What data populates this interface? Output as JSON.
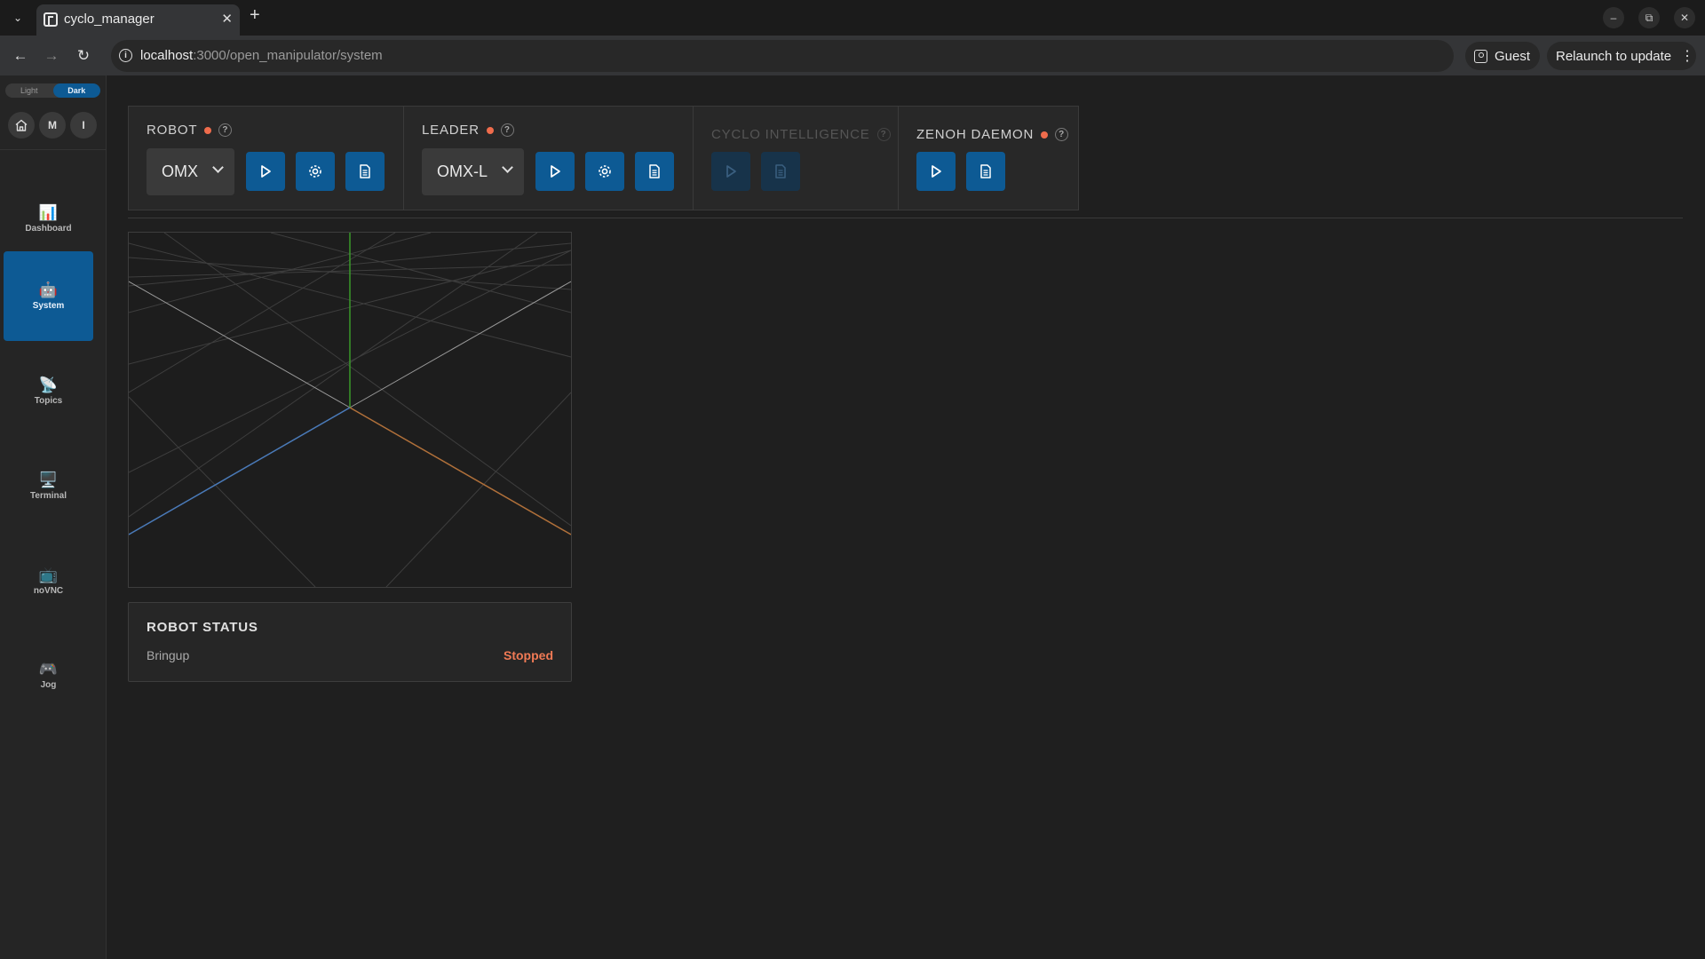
{
  "browser": {
    "tab_title": "cyclo_manager",
    "url_host": "localhost",
    "url_path": ":3000/open_manipulator/system",
    "profile_label": "Guest",
    "relaunch_label": "Relaunch to update"
  },
  "theme_toggle": {
    "light": "Light",
    "dark": "Dark",
    "selected": "Dark"
  },
  "quick_buttons": {
    "m": "M",
    "i": "I"
  },
  "sidebar": {
    "items": [
      {
        "label": "Dashboard",
        "icon": "📊"
      },
      {
        "label": "System",
        "icon": "🤖"
      },
      {
        "label": "Topics",
        "icon": "📡"
      },
      {
        "label": "Terminal",
        "icon": "🖥️"
      },
      {
        "label": "noVNC",
        "icon": "📺"
      },
      {
        "label": "Jog",
        "icon": "🎮"
      }
    ],
    "active": "System"
  },
  "sections": {
    "robot": {
      "title": "ROBOT",
      "help": "?",
      "selected": "OMX"
    },
    "leader": {
      "title": "LEADER",
      "help": "?",
      "selected": "OMX-L"
    },
    "cyclo": {
      "title": "CYCLO INTELLIGENCE",
      "help": "?"
    },
    "zenoh": {
      "title": "ZENOH DAEMON",
      "help": "?"
    }
  },
  "robot_status": {
    "title": "ROBOT STATUS",
    "key": "Bringup",
    "value": "Stopped"
  },
  "colors": {
    "accent": "#0d5a94",
    "status_dot": "#ef6c4c",
    "stopped": "#f07a55",
    "axis_x": "#b0703a",
    "axis_y": "#3a9a2a",
    "axis_z": "#4a7ab8"
  }
}
